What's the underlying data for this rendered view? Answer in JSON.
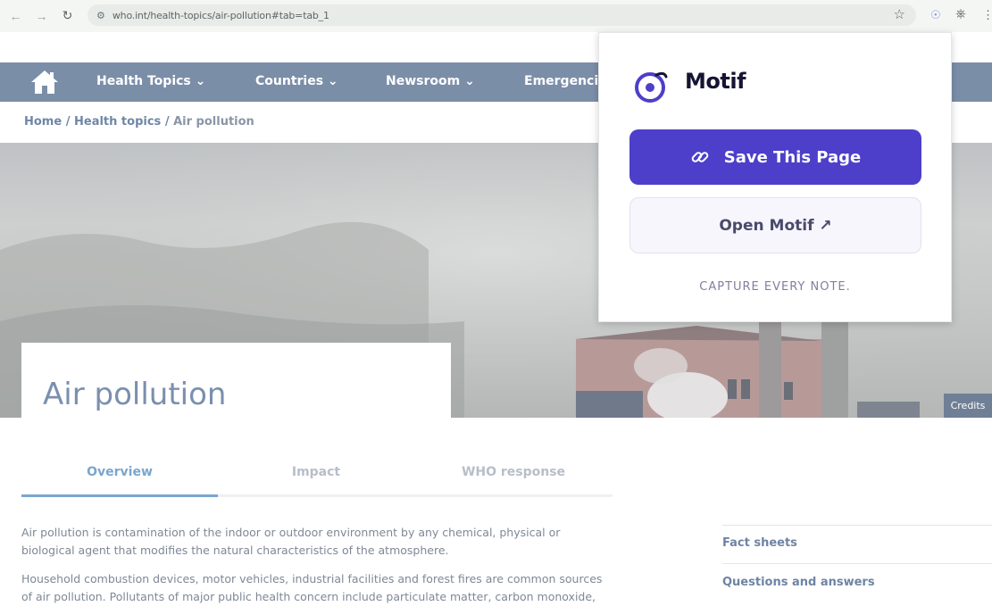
{
  "browser": {
    "url": "who.int/health-topics/air-pollution#tab=tab_1",
    "back_icon": "arrow-left-icon",
    "forward_icon": "arrow-right-icon",
    "reload_icon": "reload-icon"
  },
  "site_nav": {
    "items": [
      "Health Topics",
      "Countries",
      "Newsroom",
      "Emergencie"
    ]
  },
  "breadcrumb": {
    "home": "Home",
    "sep1": "/",
    "topics": "Health topics",
    "sep2": "/",
    "current": "Air pollution"
  },
  "hero": {
    "title": "Air pollution",
    "credits": "Credits"
  },
  "tabs": [
    "Overview",
    "Impact",
    "WHO response"
  ],
  "content": {
    "p1": "Air pollution is contamination of the indoor or outdoor environment by any chemical, physical or biological agent that modifies the natural characteristics of the atmosphere.",
    "p2": "Household combustion devices, motor vehicles, industrial facilities and forest fires are common sources of air pollution. Pollutants of major public health concern include particulate matter, carbon monoxide,"
  },
  "sidebar": {
    "links": [
      "Fact sheets",
      "Questions and answers"
    ]
  },
  "popup": {
    "brand": "Motif",
    "save_label": "Save This Page",
    "open_label": "Open Motif ↗",
    "tagline": "CAPTURE EVERY NOTE."
  },
  "colors": {
    "nav_bg": "#7b8ea8",
    "accent": "#7aa6cf",
    "motif_purple": "#4d3fc9"
  }
}
